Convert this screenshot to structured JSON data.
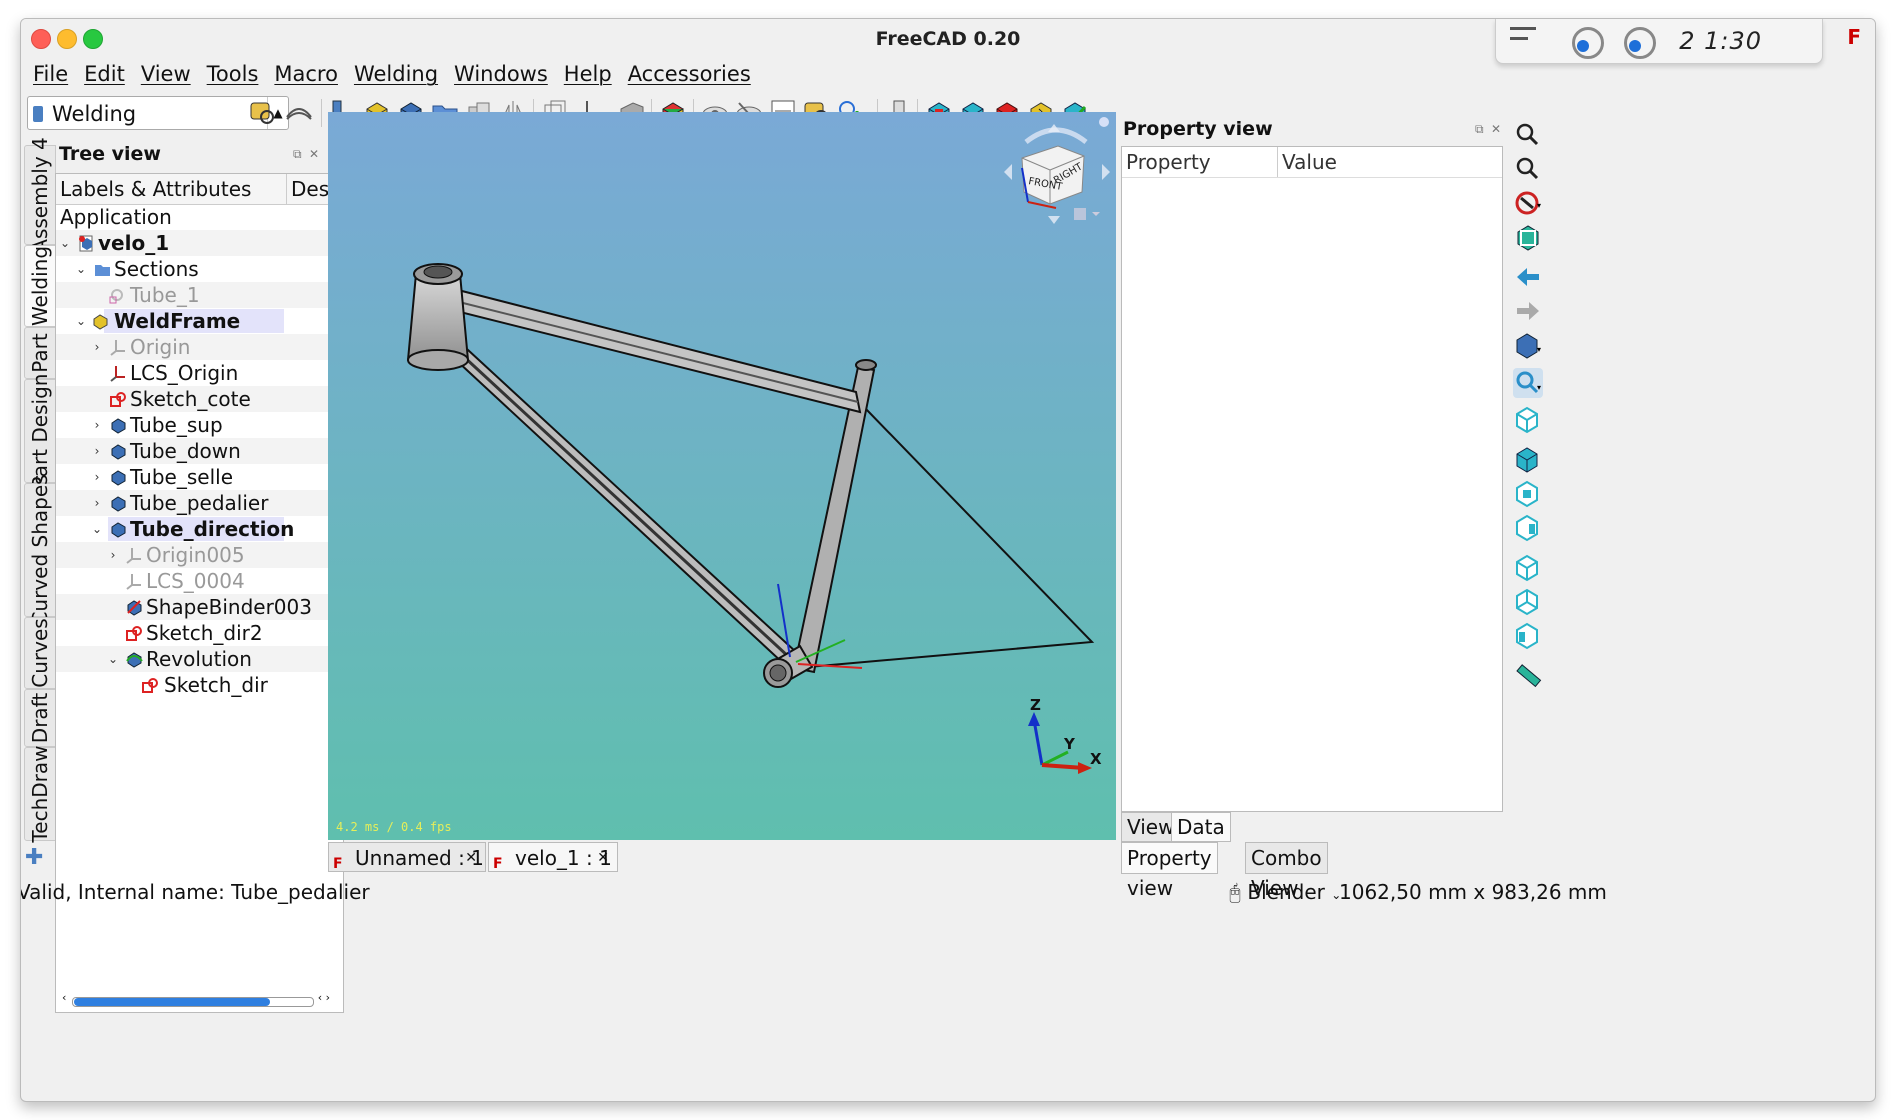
{
  "window": {
    "title": "FreeCAD 0.20"
  },
  "tray": {
    "clock": "2 1:30"
  },
  "menu": [
    "File",
    "Edit",
    "View",
    "Tools",
    "Macro",
    "Welding",
    "Windows",
    "Help",
    "Accessories"
  ],
  "toolbar": {
    "workbench": "Welding"
  },
  "left_tabs": [
    "Assembly 4",
    "Welding",
    "Part",
    "Part Design",
    "Curved Shapes",
    "Curves",
    "Draft",
    "TechDraw"
  ],
  "tree": {
    "title": "Tree view",
    "col_labels": "Labels & Attributes",
    "col_desc": "Desc",
    "rows": [
      {
        "label": "Application"
      },
      {
        "label": "velo_1"
      },
      {
        "label": "Sections"
      },
      {
        "label": "Tube_1"
      },
      {
        "label": "WeldFrame"
      },
      {
        "label": "Origin"
      },
      {
        "label": "LCS_Origin"
      },
      {
        "label": "Sketch_cote"
      },
      {
        "label": "Tube_sup"
      },
      {
        "label": "Tube_down"
      },
      {
        "label": "Tube_selle"
      },
      {
        "label": "Tube_pedalier"
      },
      {
        "label": "Tube_direction"
      },
      {
        "label": "Origin005"
      },
      {
        "label": "LCS_0004"
      },
      {
        "label": "ShapeBinder003"
      },
      {
        "label": "Sketch_dir2"
      },
      {
        "label": "Revolution"
      },
      {
        "label": "Sketch_dir"
      }
    ]
  },
  "viewport": {
    "fps_text": "4.2 ms / 0.4 fps",
    "navcube": {
      "front": "FRONT",
      "right": "RIGHT"
    },
    "axes": {
      "z": "Z",
      "y": "Y",
      "x": "X"
    }
  },
  "doc_tabs": [
    {
      "label": "Unnamed : 1"
    },
    {
      "label": "velo_1 : 1"
    }
  ],
  "property": {
    "title": "Property view",
    "col_property": "Property",
    "col_value": "Value",
    "tab_view": "View",
    "tab_data": "Data"
  },
  "combo_tabs": {
    "property_view": "Property view",
    "combo_view": "Combo View"
  },
  "status": {
    "message": "Valid, Internal name: Tube_pedalier",
    "nav_style": "Blender",
    "dimensions": "1062,50 mm x 983,26 mm"
  },
  "colors": {
    "selection": "#e3e3fa",
    "accent": "#2f7fe0",
    "viewport_top": "#7aa9d6",
    "viewport_bottom": "#5fbfae"
  }
}
